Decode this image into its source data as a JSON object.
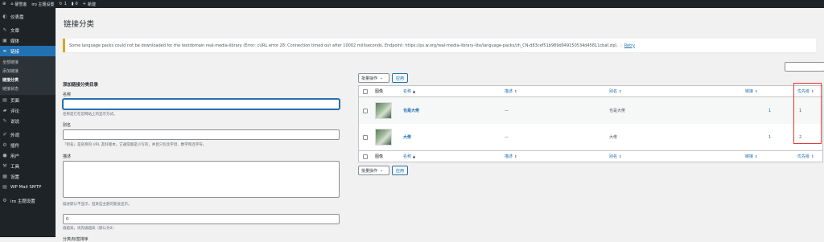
{
  "adminbar": {
    "items": [
      {
        "icon": "wordpress-icon",
        "label": ""
      },
      {
        "icon": "home-icon",
        "label": "硬雪客"
      },
      {
        "icon": "",
        "label": "iro 主题设置"
      },
      {
        "icon": "updates-icon",
        "label": "1"
      },
      {
        "icon": "comment-icon",
        "label": "0"
      },
      {
        "icon": "plus-icon",
        "label": "新建"
      }
    ]
  },
  "sidebar": {
    "items": [
      {
        "key": "dashboard",
        "icon": "dashboard-icon",
        "glyph": "◐",
        "label": "仪表盘"
      },
      {
        "key": "posts",
        "icon": "pin-icon",
        "glyph": "✎",
        "label": "文章"
      },
      {
        "key": "media",
        "icon": "media-icon",
        "glyph": "▣",
        "label": "媒体"
      },
      {
        "key": "links",
        "icon": "link-icon",
        "glyph": "∞",
        "label": "链接",
        "active": true
      },
      {
        "key": "pages",
        "icon": "page-icon",
        "glyph": "▤",
        "label": "页面"
      },
      {
        "key": "comments",
        "icon": "comment-icon",
        "glyph": "▰",
        "label": "评论"
      },
      {
        "key": "talk",
        "icon": "pin-icon",
        "glyph": "✎",
        "label": "说说"
      },
      {
        "key": "appearance",
        "icon": "brush-icon",
        "glyph": "✐",
        "label": "外观"
      },
      {
        "key": "plugins",
        "icon": "plugin-icon",
        "glyph": "⚙",
        "label": "插件"
      },
      {
        "key": "users",
        "icon": "user-icon",
        "glyph": "●",
        "label": "用户"
      },
      {
        "key": "tools",
        "icon": "wrench-icon",
        "glyph": "⚒",
        "label": "工具"
      },
      {
        "key": "settings",
        "icon": "settings-icon",
        "glyph": "▦",
        "label": "设置"
      },
      {
        "key": "smtp",
        "icon": "mail-icon",
        "glyph": "▤",
        "label": "WP Mail SMTP"
      },
      {
        "key": "iro",
        "icon": "settings-icon",
        "glyph": "⚙",
        "label": "iro 主题设置"
      }
    ],
    "submenu": [
      {
        "label": "全部链接",
        "current": false
      },
      {
        "label": "添加链接",
        "current": false
      },
      {
        "label": "链接分类",
        "current": true
      },
      {
        "label": "链接状态",
        "current": false
      }
    ]
  },
  "page": {
    "title": "链接分类"
  },
  "notice": {
    "text": "Some language packs could not be downloaded for the textdomain real-media-library (Error: cURL error 28: Connection timed out after 10002 milliseconds, Endpoint: https://ps.w.org/real-media-library-lite/language-packs/zh_CN-d83cef51b989d949150534d45811cbaf.zip).",
    "separator": "|",
    "retry": "Retry"
  },
  "form": {
    "heading": "添加链接分类目录",
    "name_label": "名称",
    "name_value": "",
    "name_desc": "名称是它在您网站上的显示方式。",
    "slug_label": "别名",
    "slug_value": "",
    "slug_desc": "「别名」是名称的 URL 友好版本。它通常都是小写的，并且只包含字母、数字和连字符。",
    "desc_label": "描述",
    "desc_desc": "描述默认不显示，但某些主题可能会显示。",
    "order_value": "0",
    "order_desc": "值越高，优先级越高（默认为0）",
    "sort_label": "分类/标签排序"
  },
  "table": {
    "bulk_label": "批量操作",
    "apply_label": "应用",
    "columns": {
      "image": "图像",
      "name": "名称",
      "desc": "描述",
      "slug": "别名",
      "links": "链接",
      "priority": "优先级"
    },
    "rows": [
      {
        "name": "也是大佬",
        "desc": "—",
        "slug": "也是大佬",
        "links": "1",
        "priority": "1"
      },
      {
        "name": "大佬",
        "desc": "—",
        "slug": "大佬",
        "links": "1",
        "priority": "2"
      }
    ]
  },
  "colors": {
    "adminbar_bg": "#1d2327",
    "accent": "#2271b1",
    "notice_border": "#dba617",
    "highlight": "#e53935"
  }
}
